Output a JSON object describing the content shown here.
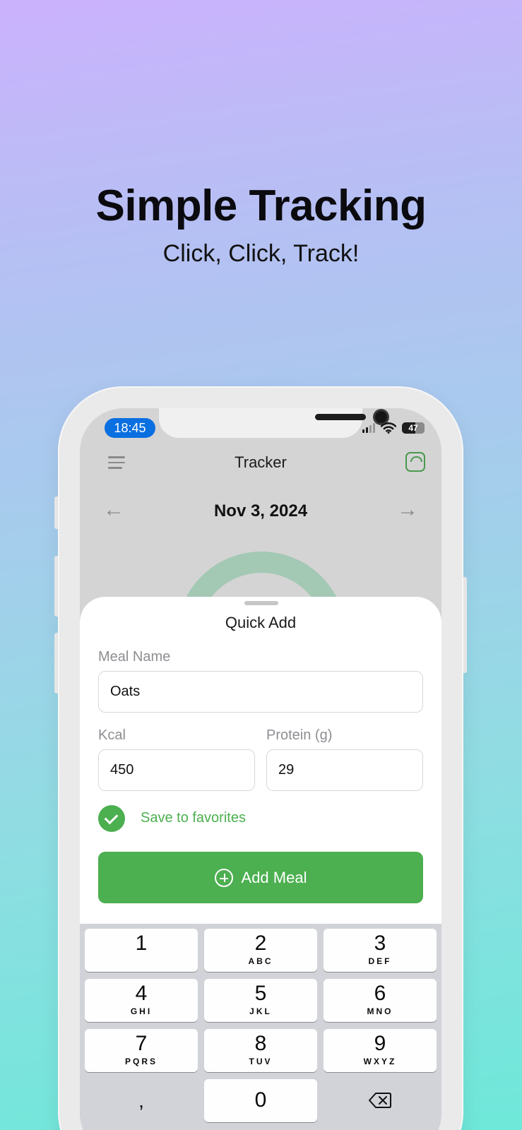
{
  "headline": "Simple Tracking",
  "subheadline": "Click, Click, Track!",
  "status_bar": {
    "time": "18:45",
    "battery": "47",
    "icons": [
      "cellular-signal-icon",
      "wifi-icon",
      "battery-icon"
    ]
  },
  "app_bar": {
    "title": "Tracker",
    "left_icon": "menu-icon",
    "right_icon": "scale-icon"
  },
  "date_nav": {
    "date": "Nov 3, 2024",
    "prev": "←",
    "next": "→"
  },
  "sheet": {
    "title": "Quick Add",
    "meal_name": {
      "label": "Meal Name",
      "value": "Oats"
    },
    "kcal": {
      "label": "Kcal",
      "value": "450"
    },
    "protein": {
      "label": "Protein (g)",
      "value": "29"
    },
    "favorite": {
      "label": "Save to favorites",
      "checked": true
    },
    "add_button": "Add Meal"
  },
  "keypad": {
    "keys": [
      {
        "digit": "1",
        "letters": ""
      },
      {
        "digit": "2",
        "letters": "ABC"
      },
      {
        "digit": "3",
        "letters": "DEF"
      },
      {
        "digit": "4",
        "letters": "GHI"
      },
      {
        "digit": "5",
        "letters": "JKL"
      },
      {
        "digit": "6",
        "letters": "MNO"
      },
      {
        "digit": "7",
        "letters": "PQRS"
      },
      {
        "digit": "8",
        "letters": "TUV"
      },
      {
        "digit": "9",
        "letters": "WXYZ"
      }
    ],
    "comma": ",",
    "zero": "0"
  },
  "colors": {
    "accent": "#4caf50",
    "time_pill": "#0a6fe0"
  }
}
